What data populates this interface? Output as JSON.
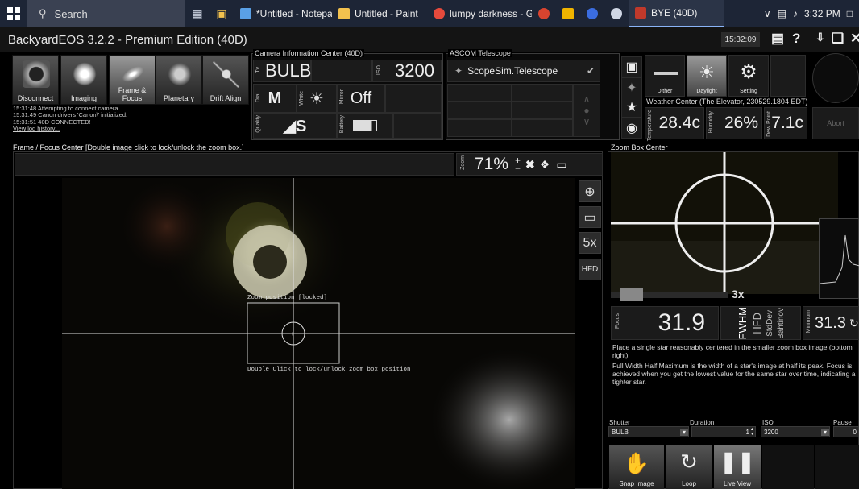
{
  "taskbar": {
    "search": "Search",
    "tasks": [
      {
        "label": "*Untitled - Notepad",
        "color": "#5aa0e6"
      },
      {
        "label": "Untitled - Paint",
        "color": "#f2c14e"
      },
      {
        "label": "lumpy darkness - Go...",
        "color": "#e64a3c"
      },
      {
        "label": "BYE (40D)",
        "color": "#c0392b"
      }
    ],
    "time": "3:32 PM"
  },
  "app": {
    "title": "BackyardEOS 3.2.2 - Premium Edition (40D)",
    "clock": "15:32:09"
  },
  "modes": [
    {
      "label": "Disconnect"
    },
    {
      "label": "Imaging"
    },
    {
      "label": "Frame &\nFocus"
    },
    {
      "label": "Planetary"
    },
    {
      "label": "Drift Align"
    }
  ],
  "log": {
    "lines": [
      "15:31:48  Attempting to connect camera...",
      "15:31:49  Canon drivers 'Canon\\' initialized.",
      "15:31:51  40D CONNECTED!"
    ],
    "history_link": "View log history..."
  },
  "camera_info": {
    "title": "Camera Information Center (40D)",
    "tv_label": "Tv",
    "shutter": "BULB",
    "iso_label": "ISO",
    "iso": "3200",
    "dial_label": "Dial",
    "mode": "M",
    "white_label": "White",
    "mirror_label": "Mirror",
    "mirror": "Off",
    "quality_label": "Quality",
    "battery_label": "Battery"
  },
  "ascom": {
    "title": "ASCOM Telescope",
    "telescope": "ScopeSim.Telescope"
  },
  "weather": {
    "dither": "Dither",
    "daylight": "Daylight",
    "setting": "Setting",
    "title": "Weather Center (The Elevator, 230529.1804 EDT)",
    "temp_label": "Temperature",
    "temperature": "28.4c",
    "humidity_label": "Humidity",
    "humidity": "26%",
    "dew_label": "Dew Point",
    "dew_point": "7.1c",
    "abort": "Abort"
  },
  "frame_focus": {
    "title": "Frame / Focus Center  [Double image click to lock/unlock the zoom box.]",
    "zoom_label": "Zoom",
    "zoom": "71%",
    "overlay_top": "Zoom position [locked]",
    "overlay_bottom": "Double Click to lock/unlock zoom box position",
    "sidebtn_5x": "5x",
    "sidebtn_hfd": "HFD"
  },
  "zoom_box": {
    "title": "Zoom Box Center",
    "zoom_factor": "3x",
    "focus_label": "Focus",
    "fwhm_value": "31.9",
    "tabs": [
      "FWHM",
      "HFD",
      "StdDev",
      "Bahtinov"
    ],
    "min_label": "Minimum",
    "min_value": "31.3",
    "help1": "Place a single star reasonably centered in the smaller zoom box image (bottom right).",
    "help2": "Full Width Half Maximum is the width of a star's image at half its peak. Focus is achieved when you get the lowest value for the same star over time, indicating a tighter star."
  },
  "capture": {
    "shutter_label": "Shutter",
    "shutter": "BULB",
    "duration_label": "Duration",
    "duration": "1",
    "iso_label": "ISO",
    "iso": "3200",
    "pause_label": "Pause",
    "pause": "0",
    "snap": "Snap Image",
    "loop": "Loop",
    "live": "Live View"
  }
}
